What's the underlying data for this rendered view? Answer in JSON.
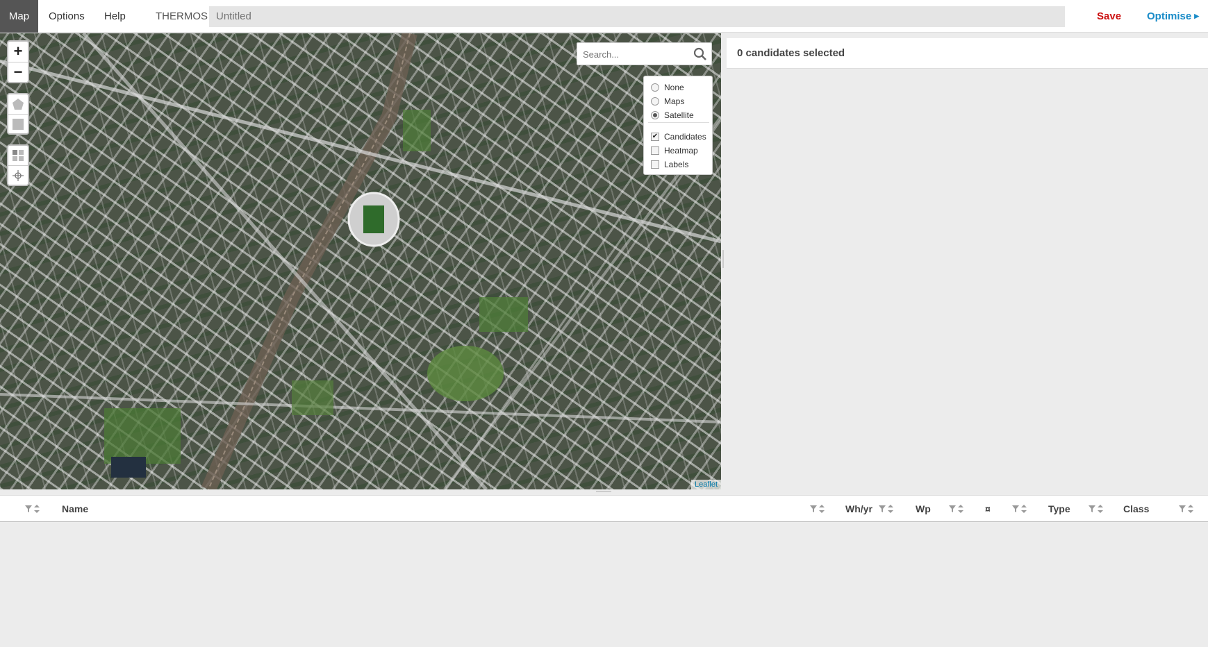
{
  "topbar": {
    "tabs": [
      {
        "label": "Map",
        "active": true
      },
      {
        "label": "Options",
        "active": false
      },
      {
        "label": "Help",
        "active": false
      }
    ],
    "app_name": "THERMOS",
    "title_placeholder": "Untitled",
    "save_label": "Save",
    "optimise_label": "Optimise",
    "save_color": "#cc1111",
    "optimise_color": "#1a8cc8"
  },
  "map": {
    "zoom_in": "+",
    "zoom_out": "−",
    "draw_tools": [
      "polygon-icon",
      "rectangle-icon"
    ],
    "tools": [
      "grid-icon",
      "locate-icon"
    ],
    "search_placeholder": "Search...",
    "layers": {
      "basemaps": [
        {
          "label": "None",
          "selected": false
        },
        {
          "label": "Maps",
          "selected": false
        },
        {
          "label": "Satellite",
          "selected": true
        }
      ],
      "overlays": [
        {
          "label": "Candidates",
          "checked": true
        },
        {
          "label": "Heatmap",
          "checked": false
        },
        {
          "label": "Labels",
          "checked": false
        }
      ]
    },
    "attribution": "Leaflet"
  },
  "selection": {
    "summary": "0 candidates selected"
  },
  "table": {
    "columns": [
      "Name",
      "Wh/yr",
      "Wp",
      "¤",
      "Type",
      "Class"
    ]
  }
}
